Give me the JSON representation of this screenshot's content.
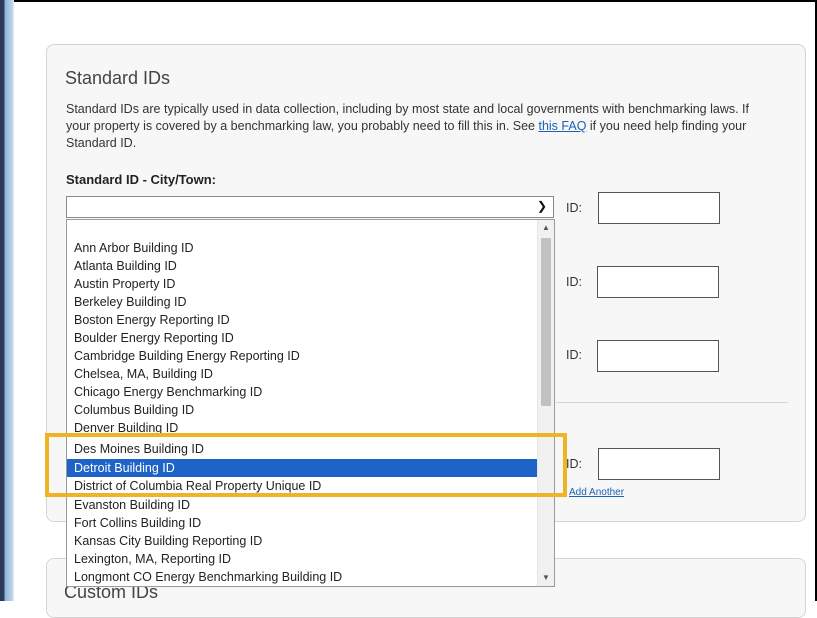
{
  "standard_ids": {
    "title": "Standard IDs",
    "description_before_link": "Standard IDs are typically used in data collection, including by most state and local governments with benchmarking laws. If your property is covered by a benchmarking law, you probably need to fill this in. See ",
    "faq_link": "this FAQ",
    "description_after_link": " if you need help finding your Standard ID.",
    "city_label": "Standard ID - City/Town:",
    "city_select_value": "",
    "id_label": "ID:",
    "add_another": "Add Another"
  },
  "dropdown": {
    "options": [
      "",
      "Ann Arbor Building ID",
      "Atlanta Building ID",
      "Austin Property ID",
      "Berkeley Building ID",
      "Boston Energy Reporting ID",
      "Boulder Energy Reporting ID",
      "Cambridge Building Energy Reporting ID",
      "Chelsea, MA, Building ID",
      "Chicago Energy Benchmarking ID",
      "Columbus Building ID",
      "Denver Building ID",
      "Des Moines Building ID",
      "Detroit Building ID",
      "District of Columbia Real Property Unique ID",
      "Evanston Building ID",
      "Fort Collins Building ID",
      "Kansas City Building Reporting ID",
      "Lexington, MA, Reporting ID",
      "Longmont CO Energy Benchmarking Building ID"
    ],
    "selected": "Detroit Building ID"
  },
  "custom_ids": {
    "title": "Custom IDs"
  },
  "colors": {
    "selection": "#1e64c8",
    "highlight_box": "#f0b323",
    "link": "#1f5fb4"
  }
}
